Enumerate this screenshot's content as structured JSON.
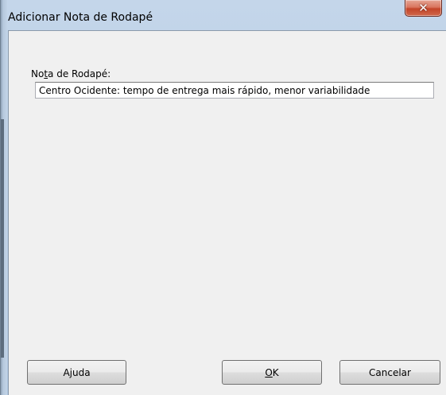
{
  "window": {
    "title": "Adicionar Nota de Rodapé",
    "close_glyph": "✕"
  },
  "form": {
    "label_prefix": "No",
    "label_mnemonic": "t",
    "label_suffix": "a de Rodapé:",
    "value": "Centro Ocidente: tempo de entrega mais rápido, menor variabilidade"
  },
  "buttons": {
    "help_label": "Ajuda",
    "ok_mnemonic": "O",
    "ok_rest": "K",
    "cancel_label": "Cancelar"
  },
  "icons": {
    "close": "close-icon"
  },
  "colors": {
    "close_button": "#c9553b",
    "title_frame": "#b9cde4",
    "client_bg": "#f0f0f0"
  }
}
